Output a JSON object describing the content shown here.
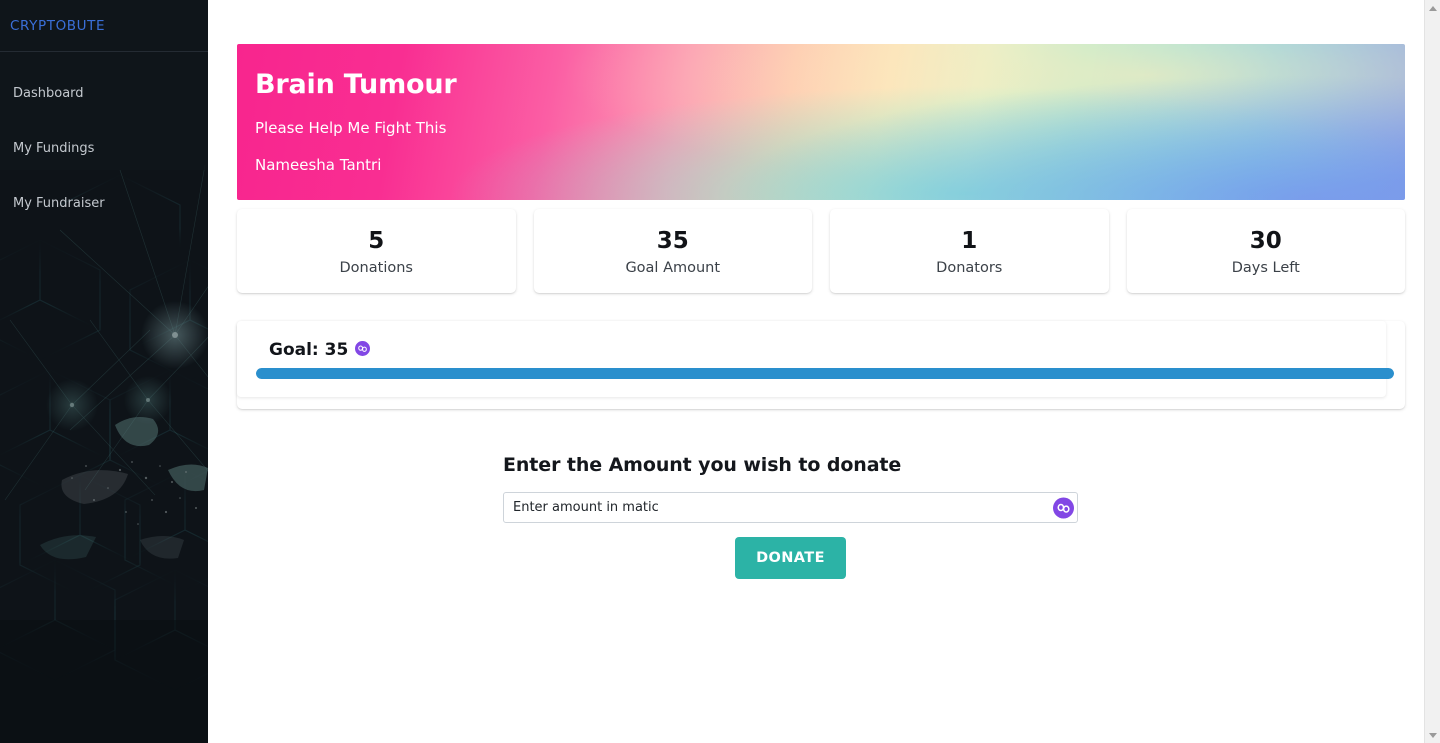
{
  "sidebar": {
    "brand": "CRYPTOBUTE",
    "items": [
      {
        "label": "Dashboard",
        "icon": "dashboard-icon"
      },
      {
        "label": "My Fundings",
        "icon": "fundings-icon"
      },
      {
        "label": "My Fundraiser",
        "icon": "fundraiser-icon"
      }
    ],
    "background_theme": "blockchain-cubes-dark",
    "brand_color": "#3a6fd8",
    "bg_color": "#10161b"
  },
  "banner": {
    "title": "Brain Tumour",
    "subtitle": "Please Help Me Fight This",
    "organizer": "Nameesha Tantri",
    "gradient_start": "#f8258e",
    "gradient_end": "#7f9fe9"
  },
  "stats": [
    {
      "value": "5",
      "label": "Donations"
    },
    {
      "value": "35",
      "label": "Goal Amount"
    },
    {
      "value": "1",
      "label": "Donators"
    },
    {
      "value": "30",
      "label": "Days Left"
    }
  ],
  "goal": {
    "label": "Goal: 35",
    "currency_icon": "matic-icon",
    "progress_percent": 100,
    "progress_color": "#2a8fcd"
  },
  "donate": {
    "heading": "Enter the Amount you wish to donate",
    "input_value": "",
    "input_placeholder": "Enter amount in matic",
    "currency_icon": "matic-icon",
    "button_label": "DONATE",
    "button_color": "#2cb3a6"
  },
  "scrollbar": {
    "up_arrow": "chevron-up-icon",
    "down_arrow": "chevron-down-icon"
  }
}
